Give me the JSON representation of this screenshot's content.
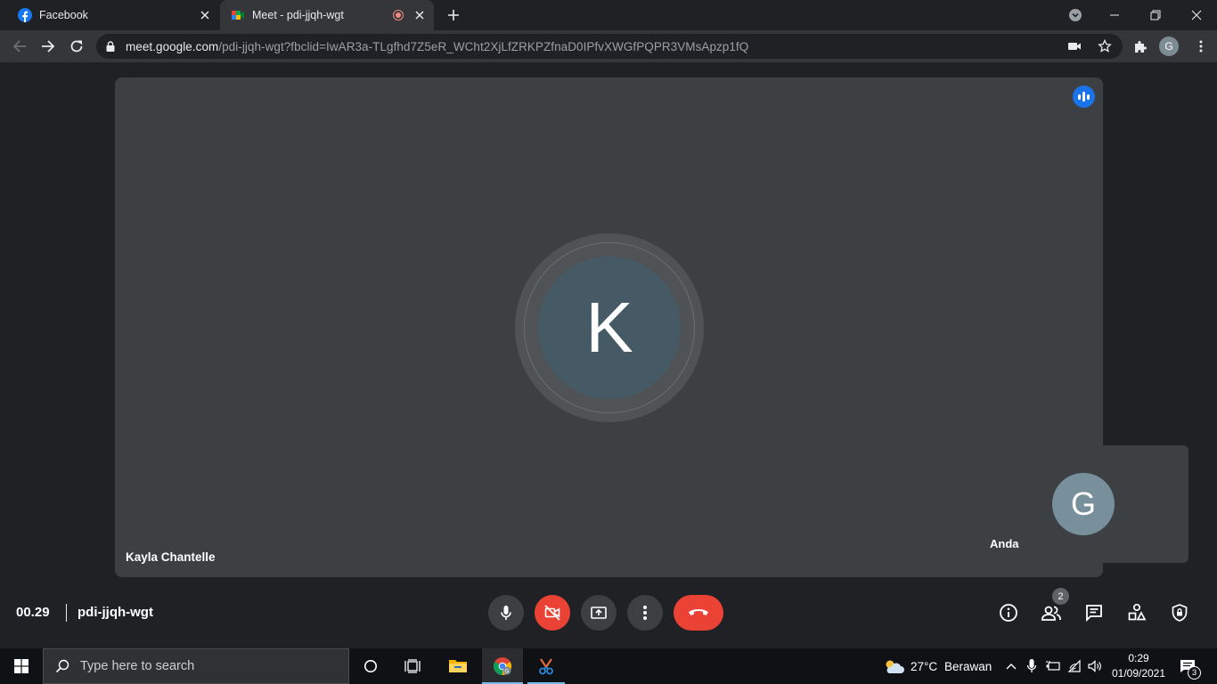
{
  "browser": {
    "tabs": [
      {
        "title": "Facebook",
        "icon": "facebook-icon"
      },
      {
        "title": "Meet - pdi-jjqh-wgt",
        "icon": "google-meet-icon",
        "recording": true
      }
    ],
    "url_host": "meet.google.com",
    "url_path": "/pdi-jjqh-wgt?fbclid=IwAR3a-TLgfhd7Z5eR_WCht2XjLfZRKPZfnaD0IPfvXWGfPQPR3VMsApzp1fQ",
    "profile_initial": "G"
  },
  "meet": {
    "main_participant": {
      "name": "Kayla Chantelle",
      "initial": "K"
    },
    "self_participant": {
      "name": "Anda",
      "initial": "G"
    },
    "time": "00.29",
    "meeting_code": "pdi-jjqh-wgt",
    "participant_count": "2",
    "colors": {
      "end_call": "#ea4335",
      "speaking": "#1a73e8",
      "tile": "#3c4043"
    }
  },
  "taskbar": {
    "search_placeholder": "Type here to search",
    "weather_temp": "27°C",
    "weather_desc": "Berawan",
    "time": "0:29",
    "date": "01/09/2021",
    "notification_count": "3"
  }
}
